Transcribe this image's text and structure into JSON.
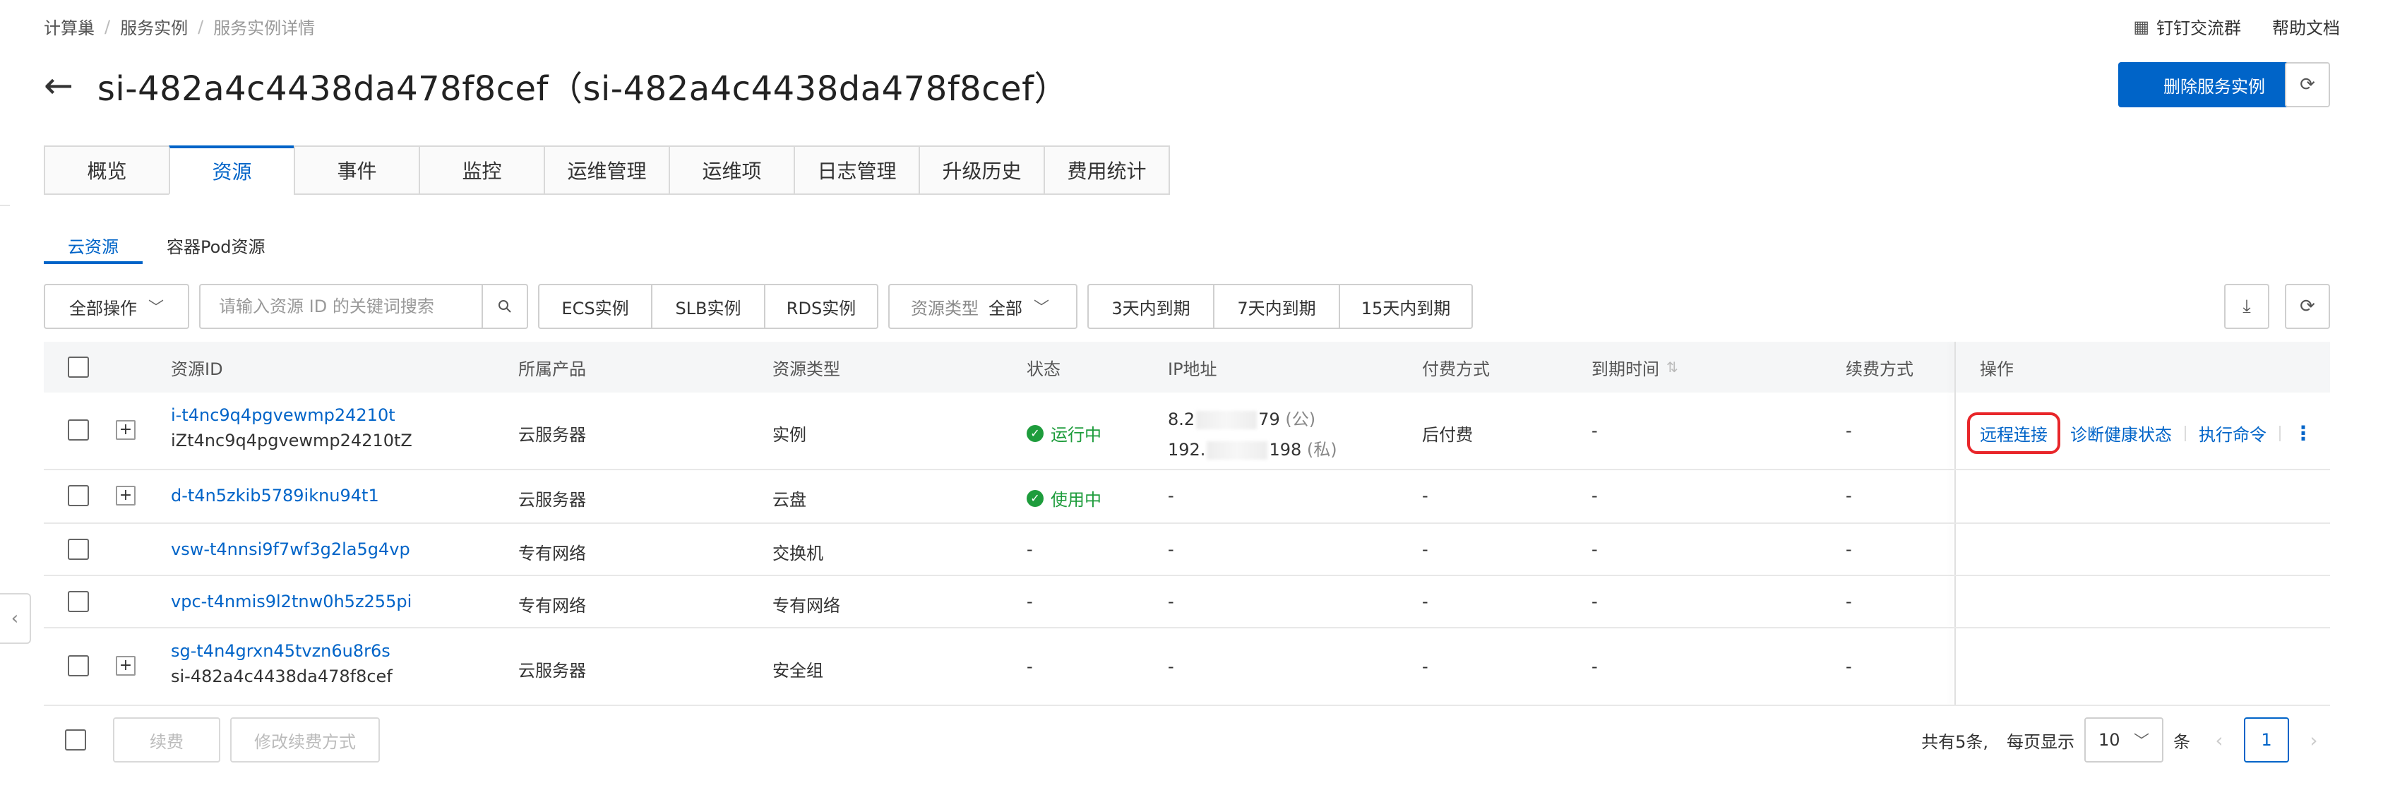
{
  "breadcrumb": {
    "items": [
      "计算巢",
      "服务实例",
      "服务实例详情"
    ]
  },
  "top_links": {
    "dingtalk": "钉钉交流群",
    "help": "帮助文档"
  },
  "header": {
    "title": "si-482a4c4438da478f8cef（si-482a4c4438da478f8cef）",
    "delete_button": "删除服务实例"
  },
  "main_tabs": [
    "概览",
    "资源",
    "事件",
    "监控",
    "运维管理",
    "运维项",
    "日志管理",
    "升级历史",
    "费用统计"
  ],
  "main_tabs_active": "资源",
  "sub_tabs": [
    "云资源",
    "容器Pod资源"
  ],
  "sub_tabs_active": "云资源",
  "toolbar": {
    "batch_label": "全部操作",
    "search_placeholder": "请输入资源 ID 的关键词搜索",
    "type_filters": [
      "ECS实例",
      "SLB实例",
      "RDS实例"
    ],
    "resource_type_label": "资源类型",
    "resource_type_value": "全部",
    "expiry_filters": [
      "3天内到期",
      "7天内到期",
      "15天内到期"
    ]
  },
  "table": {
    "headers": [
      "资源ID",
      "所属产品",
      "资源类型",
      "状态",
      "IP地址",
      "付费方式",
      "到期时间",
      "续费方式",
      "操作"
    ],
    "rows": [
      {
        "id": "i-t4nc9q4pgvewmp24210t",
        "sub": "iZt4nc9q4pgvewmp24210tZ",
        "product": "云服务器",
        "type": "实例",
        "status": "运行中",
        "ip_public_prefix": "8.2",
        "ip_public_suffix": "79",
        "ip_public_tag": "(公)",
        "ip_private_prefix": "192.",
        "ip_private_suffix": "198",
        "ip_private_tag": "(私)",
        "pay": "后付费",
        "expire": "-",
        "renew": "-"
      },
      {
        "id": "d-t4n5zkib5789iknu94t1",
        "sub": "",
        "product": "云服务器",
        "type": "云盘",
        "status": "使用中",
        "ip": "-",
        "pay": "-",
        "expire": "-",
        "renew": "-"
      },
      {
        "id": "vsw-t4nnsi9f7wf3g2la5g4vp",
        "sub": "",
        "product": "专有网络",
        "type": "交换机",
        "status": "-",
        "ip": "-",
        "pay": "-",
        "expire": "-",
        "renew": "-"
      },
      {
        "id": "vpc-t4nmis9l2tnw0h5z255pi",
        "sub": "",
        "product": "专有网络",
        "type": "专有网络",
        "status": "-",
        "ip": "-",
        "pay": "-",
        "expire": "-",
        "renew": "-"
      },
      {
        "id": "sg-t4n4grxn45tvzn6u8r6s",
        "sub": "si-482a4c4438da478f8cef",
        "product": "云服务器",
        "type": "安全组",
        "status": "-",
        "ip": "-",
        "pay": "-",
        "expire": "-",
        "renew": "-"
      }
    ],
    "row_actions": [
      "远程连接",
      "诊断健康状态",
      "执行命令"
    ]
  },
  "footer": {
    "renew_button": "续费",
    "change_renew_button": "修改续费方式",
    "total_text": "共有5条,",
    "per_page_label": "每页显示",
    "page_size": "10",
    "unit": "条",
    "current_page": "1"
  },
  "colors": {
    "primary": "#0064c8",
    "success": "#1e9c3c",
    "highlight": "#e8262a"
  }
}
